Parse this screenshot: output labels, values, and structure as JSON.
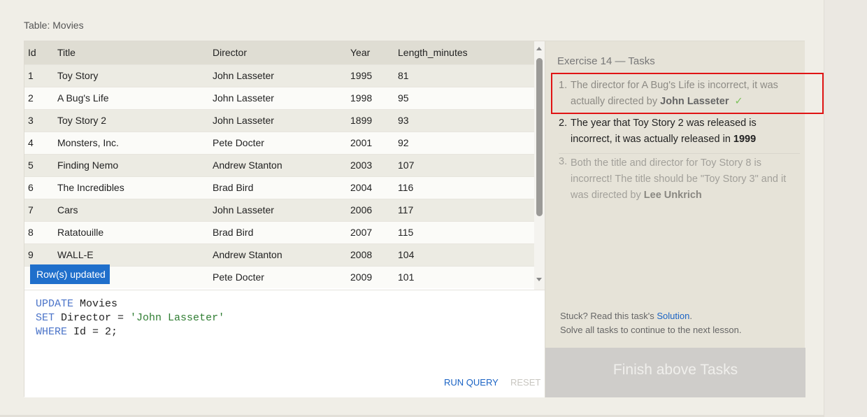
{
  "caption": "Table: Movies",
  "table": {
    "columns": [
      "Id",
      "Title",
      "Director",
      "Year",
      "Length_minutes"
    ],
    "rows": [
      [
        "1",
        "Toy Story",
        "John Lasseter",
        "1995",
        "81"
      ],
      [
        "2",
        "A Bug's Life",
        "John Lasseter",
        "1998",
        "95"
      ],
      [
        "3",
        "Toy Story 2",
        "John Lasseter",
        "1899",
        "93"
      ],
      [
        "4",
        "Monsters, Inc.",
        "Pete Docter",
        "2001",
        "92"
      ],
      [
        "5",
        "Finding Nemo",
        "Andrew Stanton",
        "2003",
        "107"
      ],
      [
        "6",
        "The Incredibles",
        "Brad Bird",
        "2004",
        "116"
      ],
      [
        "7",
        "Cars",
        "John Lasseter",
        "2006",
        "117"
      ],
      [
        "8",
        "Ratatouille",
        "Brad Bird",
        "2007",
        "115"
      ],
      [
        "9",
        "WALL-E",
        "Andrew Stanton",
        "2008",
        "104"
      ],
      [
        "",
        "",
        "Pete Docter",
        "2009",
        "101"
      ]
    ]
  },
  "toast": "Row(s) updated",
  "editor": {
    "line1_kw": "UPDATE",
    "line1_rest": " Movies",
    "line2_kw": "SET",
    "line2_rest": " Director = ",
    "line2_str": "'John Lasseter'",
    "line3_kw": "WHERE",
    "line3_rest": " Id = 2;"
  },
  "buttons": {
    "run": "RUN QUERY",
    "reset": "RESET"
  },
  "tasks": {
    "title": "Exercise 14 — Tasks",
    "t1_num": "1.",
    "t1_text": "The director for A Bug's Life is incorrect, it was actually directed by ",
    "t1_bold": "John Lasseter",
    "t1_check": "✓",
    "t2_num": "2.",
    "t2_text": "The year that Toy Story 2 was released is incorrect, it was actually released in ",
    "t2_bold": "1999",
    "t3_num": "3.",
    "t3_text": "Both the title and director for Toy Story 8 is incorrect! The title should be \"Toy Story 3\" and it was directed by ",
    "t3_bold": "Lee Unkrich"
  },
  "stuck": {
    "prefix": "Stuck? Read this task's ",
    "link": "Solution",
    "suffix": ".",
    "line2": "Solve all tasks to continue to the next lesson."
  },
  "finish": "Finish above Tasks"
}
